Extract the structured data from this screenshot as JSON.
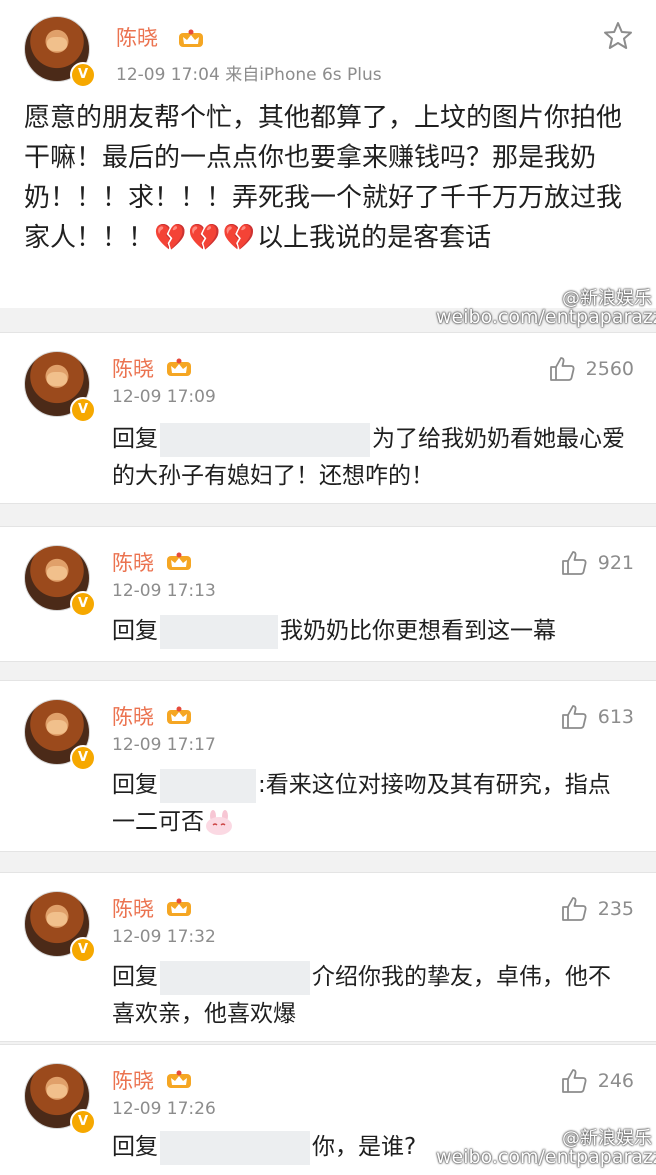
{
  "post": {
    "author": "陈晓",
    "time_source": "12-09 17:04  来自iPhone 6s Plus",
    "text_main": "愿意的朋友帮个忙，其他都算了，上坟的图片你拍他干嘛！最后的一点点你也要拿来赚钱吗？那是我奶奶！！！求！！！弄死我一个就好了千千万万放过我家人！！！",
    "hearts": "💔💔💔",
    "text_tail": "以上我说的是客套话"
  },
  "watermarks": {
    "brand": "@新浪娱乐",
    "url": "weibo.com/entpaparazzi"
  },
  "comments": [
    {
      "author": "陈晓",
      "time": "12-09 17:09",
      "likes": "2560",
      "prefix": "回复",
      "text": "为了给我奶奶看她最心爱的大孙子有媳妇了！还想咋的！"
    },
    {
      "author": "陈晓",
      "time": "12-09 17:13",
      "likes": "921",
      "prefix": "回复",
      "text": "我奶奶比你更想看到这一幕"
    },
    {
      "author": "陈晓",
      "time": "12-09 17:17",
      "likes": "613",
      "prefix": "回复",
      "text": ":看来这位对接吻及其有研究，指点一二可否"
    },
    {
      "author": "陈晓",
      "time": "12-09 17:32",
      "likes": "235",
      "prefix": "回复",
      "text": "介绍你我的挚友，卓伟，他不喜欢亲，他喜欢爆"
    },
    {
      "author": "陈晓",
      "time": "12-09 17:26",
      "likes": "246",
      "prefix": "回复",
      "text": "你，是谁?"
    }
  ],
  "icons": {
    "verified": "verified-badge-icon",
    "member": "member-crown-icon",
    "favorite": "star-outline-icon",
    "like": "thumbs-up-icon"
  },
  "colors": {
    "username": "#eb7350",
    "verified": "#f6a800",
    "text": "#1f1f1f",
    "meta": "#8c8c8c"
  }
}
